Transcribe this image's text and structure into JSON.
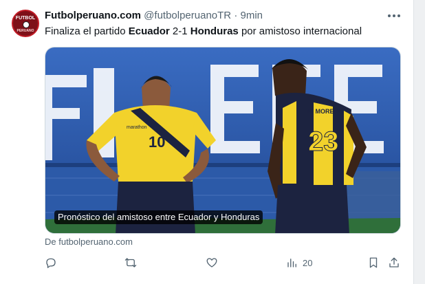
{
  "tweet": {
    "avatar": {
      "line1": "FUTBOL",
      "line2": "PERUANO",
      "colors": {
        "bg": "#7e1018",
        "ring": "#c01c26"
      }
    },
    "display_name": "Futbolperuano.com",
    "handle": "@futbolperuanoTR",
    "separator": "·",
    "time": "9min",
    "text": {
      "part1": "Finaliza el partido ",
      "team1": "Ecuador",
      "score": " 2-1 ",
      "team2": "Honduras",
      "part2": " por amistoso internacional"
    },
    "media": {
      "caption": "Pronóstico del amistoso entre Ecuador y Honduras",
      "player_left_number": "10",
      "player_left_sponsor": "marathon",
      "player_right_number": "23",
      "player_right_name": "M. MOREIN",
      "colors": {
        "wall": "#2e5fb0",
        "shirt_yellow": "#f2d22b",
        "navy": "#1c2340"
      }
    },
    "source": "De futbolperuano.com",
    "actions": {
      "views_count": "20"
    }
  }
}
